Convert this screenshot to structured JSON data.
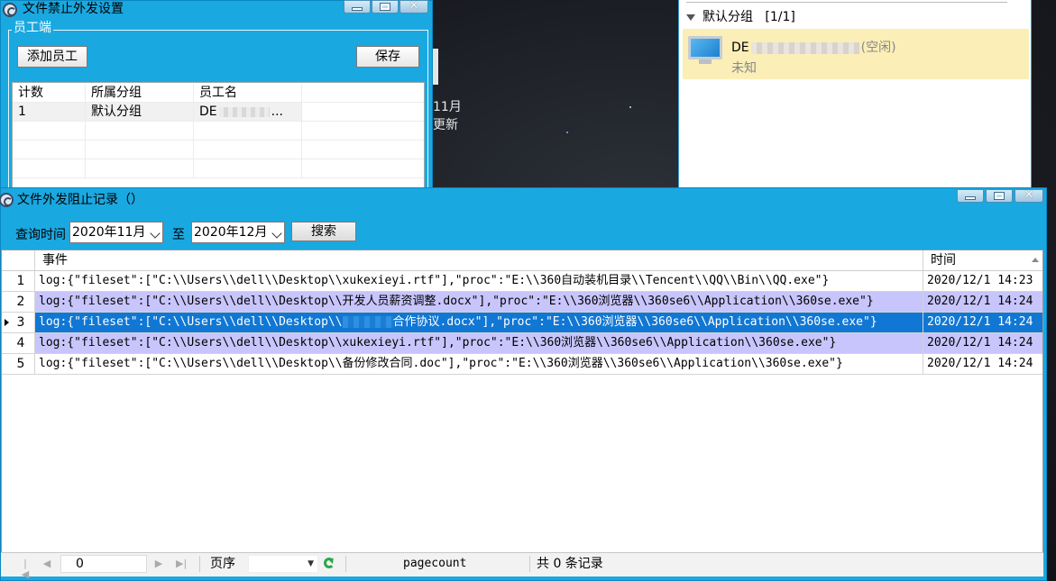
{
  "desktop": {
    "clock_month": "11月",
    "clock_sub": "更新"
  },
  "settings_window": {
    "title": "文件禁止外发设置",
    "group_label": "员工端",
    "add_button": "添加员工",
    "save_button": "保存",
    "columns": [
      "计数",
      "所属分组",
      "员工名"
    ],
    "rows": [
      {
        "count": "1",
        "group": "默认分组",
        "name": "DE",
        "name_suffix": "..."
      }
    ]
  },
  "tree_panel": {
    "group_header": "默认分组",
    "group_count": "[1/1]",
    "item_name_prefix": "DE",
    "item_state": "(空闲)",
    "item_sub": "未知"
  },
  "log_window": {
    "title": "文件外发阻止记录（）",
    "query_label": "查询时间",
    "from_value": "2020年11月",
    "to_label": "至",
    "to_value": "2020年12月",
    "search_button": "搜索",
    "columns": {
      "event": "事件",
      "time": "时间"
    },
    "rows": [
      {
        "idx": "1",
        "event": "log:{\"fileset\":[\"C:\\\\Users\\\\dell\\\\Desktop\\\\xukexieyi.rtf\"],\"proc\":\"E:\\\\360自动装机目录\\\\Tencent\\\\QQ\\\\Bin\\\\QQ.exe\"}",
        "event_tail": "",
        "time": "2020/12/1 14:23"
      },
      {
        "idx": "2",
        "event": "log:{\"fileset\":[\"C:\\\\Users\\\\dell\\\\Desktop\\\\开发人员薪资调整.docx\"],\"proc\":\"E:\\\\360浏览器\\\\360se6\\\\Application\\\\360se.exe\"}",
        "event_tail": "",
        "time": "2020/12/1 14:24"
      },
      {
        "idx": "3",
        "event": "log:{\"fileset\":[\"C:\\\\Users\\\\dell\\\\Desktop\\\\",
        "event_tail": "合作协议.docx\"],\"proc\":\"E:\\\\360浏览器\\\\360se6\\\\Application\\\\360se.exe\"}",
        "time": "2020/12/1 14:24"
      },
      {
        "idx": "4",
        "event": "log:{\"fileset\":[\"C:\\\\Users\\\\dell\\\\Desktop\\\\xukexieyi.rtf\"],\"proc\":\"E:\\\\360浏览器\\\\360se6\\\\Application\\\\360se.exe\"}",
        "event_tail": "",
        "time": "2020/12/1 14:24"
      },
      {
        "idx": "5",
        "event": "log:{\"fileset\":[\"C:\\\\Users\\\\dell\\\\Desktop\\\\备份修改合同.doc\"],\"proc\":\"E:\\\\360浏览器\\\\360se6\\\\Application\\\\360se.exe\"}",
        "event_tail": "",
        "time": "2020/12/1 14:24"
      }
    ],
    "status": {
      "page_number": "0",
      "page_order_label": "页序",
      "pagecount_label": "pagecount",
      "total_text": "共 0 条记录"
    }
  }
}
